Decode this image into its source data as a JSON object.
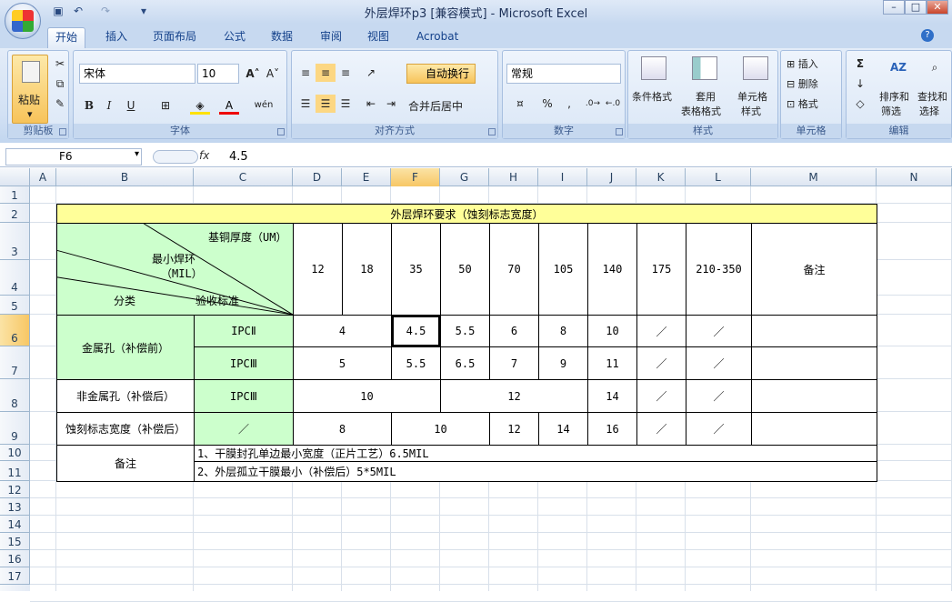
{
  "window": {
    "title": "外层焊环p3  [兼容模式] - Microsoft Excel",
    "controls": [
      "–",
      "□",
      "✕"
    ]
  },
  "quick_access": [
    "save-icon",
    "undo-icon",
    "redo-icon",
    "customize-icon"
  ],
  "tabs": [
    "开始",
    "插入",
    "页面布局",
    "公式",
    "数据",
    "审阅",
    "视图",
    "Acrobat"
  ],
  "active_tab": "开始",
  "ribbon": {
    "clipboard": {
      "title": "剪贴板",
      "paste": "粘贴"
    },
    "font": {
      "title": "字体",
      "name": "宋体",
      "size": "10"
    },
    "alignment": {
      "title": "对齐方式",
      "wrap": "自动换行",
      "merge": "合并后居中"
    },
    "number": {
      "title": "数字",
      "format": "常规"
    },
    "styles": {
      "title": "样式",
      "cond": "条件格式",
      "table1": "套用",
      "table2": "表格格式",
      "cell1": "单元格",
      "cell2": "样式"
    },
    "cells": {
      "title": "单元格",
      "insert": "插入",
      "delete": "删除",
      "format": "格式"
    },
    "editing": {
      "title": "编辑",
      "sort1": "排序和",
      "sort2": "筛选",
      "find1": "查找和",
      "find2": "选择"
    }
  },
  "formula_bar": {
    "name_box": "F6",
    "fx": "fx",
    "value": "4.5"
  },
  "columns": [
    "A",
    "B",
    "C",
    "D",
    "E",
    "F",
    "G",
    "H",
    "I",
    "J",
    "K",
    "L",
    "M",
    "N"
  ],
  "selected_column": "F",
  "rows": [
    "1",
    "2",
    "3",
    "4",
    "5",
    "6",
    "7",
    "8",
    "9",
    "10",
    "11",
    "12",
    "13",
    "14",
    "15",
    "16",
    "17"
  ],
  "selected_row": "6",
  "sheet": {
    "title": "外层焊环要求（蚀刻标志宽度）",
    "header": {
      "thickness": "基铜厚度（UM）",
      "ring_label": "最小焊环",
      "ring_unit": "（MIL）",
      "category": "分类",
      "standard": "验收标准",
      "remark": "备注"
    },
    "thickness_values": [
      "12",
      "18",
      "35",
      "50",
      "70",
      "105",
      "140",
      "175",
      "210-350"
    ],
    "metal_hole": "金属孔（补偿前）",
    "nonmetal_hole": "非金属孔（补偿后）",
    "etch_width": "蚀刻标志宽度（补偿后）",
    "ipc2": "IPCⅡ",
    "ipc3": "IPCⅢ",
    "slash": "／",
    "r6": {
      "de": "4",
      "f": "4.5",
      "g": "5.5",
      "h": "6",
      "i": "8",
      "j": "10"
    },
    "r7": {
      "de": "5",
      "f": "5.5",
      "g": "6.5",
      "h": "7",
      "i": "9",
      "j": "11"
    },
    "r8": {
      "def": "10",
      "ghi": "12",
      "j": "14"
    },
    "r9": {
      "de": "8",
      "fg": "10",
      "h": "12",
      "i": "14",
      "j": "16"
    },
    "note_label": "备注",
    "note1": "1、干膜封孔单边最小宽度（正片工艺）6.5MIL",
    "note2": "2、外层孤立干膜最小（补偿后）5*5MIL"
  }
}
